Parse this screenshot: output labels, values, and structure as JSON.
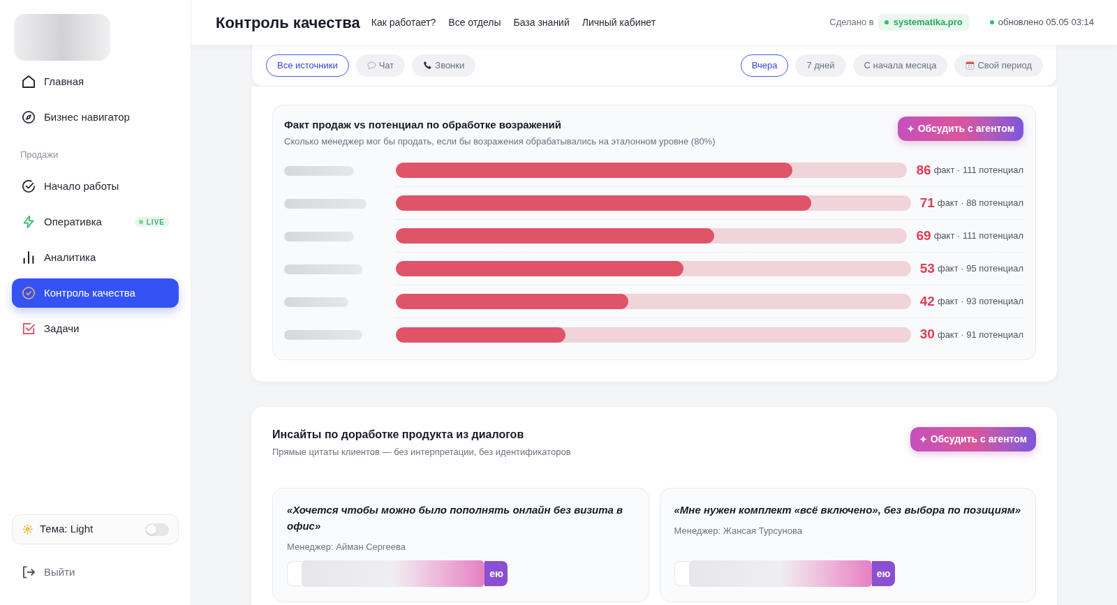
{
  "sidebar": {
    "items": [
      {
        "kind": "link",
        "label": "Главная",
        "selected": false
      },
      {
        "kind": "link",
        "label": "Бизнес навигатор",
        "selected": false
      },
      {
        "kind": "section",
        "label": "Продажи"
      },
      {
        "kind": "link",
        "label": "Начало работы",
        "selected": false
      },
      {
        "kind": "link",
        "label": "Оперативка",
        "badge": "LIVE",
        "selected": false
      },
      {
        "kind": "link",
        "label": "Аналитика",
        "selected": false
      },
      {
        "kind": "link",
        "label": "Контроль качества",
        "selected": true
      },
      {
        "kind": "link",
        "label": "Задачи",
        "selected": false
      }
    ],
    "theme_toggle": {
      "label": "Тема: Light",
      "on": false
    },
    "logout": {
      "label": "Выйти"
    }
  },
  "header": {
    "title": "Контроль качества",
    "nav": [
      "Как работает?",
      "Все отделы",
      "База знаний",
      "Личный кабинет"
    ],
    "made_in_label": "Сделано в",
    "made_in_link": "systematika.pro",
    "updated": "обновлено 05.05 03:14"
  },
  "filters": {
    "sources": [
      {
        "label": "Все источники",
        "selected": true
      },
      {
        "label": "Чат",
        "selected": false
      },
      {
        "label": "Звонки",
        "selected": false
      }
    ],
    "periods": [
      {
        "label": "Вчера",
        "selected": true
      },
      {
        "label": "7 дней",
        "selected": false
      },
      {
        "label": "С начала месяца",
        "selected": false
      },
      {
        "label": "Свой период",
        "selected": false
      }
    ]
  },
  "sales_chart": {
    "title": "Факт продаж vs потенциал по обработке возражений",
    "subtitle": "Сколько менеджер мог бы продать, если бы возражения обрабатывались на эталонном уровне (80%)",
    "action": "Обсудить с агентом",
    "rows": [
      {
        "fact": "86",
        "detail": "факт · 111 потенциал",
        "level": 0.775
      },
      {
        "fact": "71",
        "detail": "факт · 88 потенциал",
        "level": 0.807
      },
      {
        "fact": "69",
        "detail": "факт · 111 потенциал",
        "level": 0.622
      },
      {
        "fact": "53",
        "detail": "факт · 95 потенциал",
        "level": 0.558
      },
      {
        "fact": "42",
        "detail": "факт · 93 потенциал",
        "level": 0.452
      },
      {
        "fact": "30",
        "detail": "факт · 91 потенциал",
        "level": 0.33
      }
    ]
  },
  "insights": {
    "title": "Инсайты по доработке продукта из диалогов",
    "subtitle": "Прямые цитаты клиентов — без интерпретации, без идентификаторов",
    "action": "Обсудить с агентом",
    "quotes": [
      {
        "text": "«Хочется чтобы можно было пополнять онлайн без визита в офис»",
        "manager": "Менеджер: Айман Сергеева",
        "button": "ею"
      },
      {
        "text": "«Мне нужен комплект «всё включено», без выбора по позициям»",
        "manager": "Менеджер: Жансая Турсунова",
        "button": "ею"
      }
    ]
  }
}
